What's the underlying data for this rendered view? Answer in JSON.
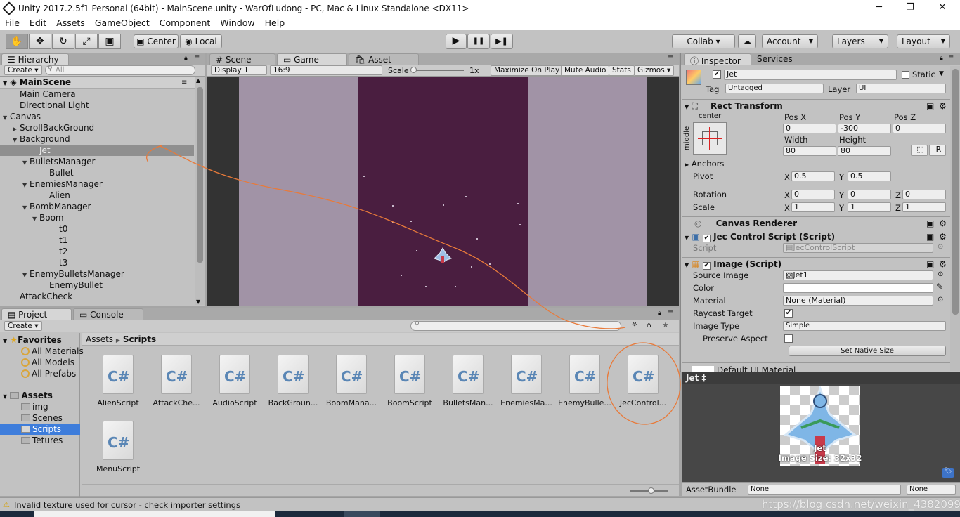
{
  "window": {
    "title": "Unity 2017.2.5f1 Personal (64bit) - MainScene.unity - WarOfLudong - PC, Mac & Linux Standalone <DX11>",
    "minimize": "─",
    "maximize": "❐",
    "close": "✕"
  },
  "menu": [
    "File",
    "Edit",
    "Assets",
    "GameObject",
    "Component",
    "Window",
    "Help"
  ],
  "toolbar": {
    "tools": [
      "✋",
      "✥",
      "↻",
      "⤢",
      "▣"
    ],
    "center": "Center",
    "local": "Local",
    "play": "▶",
    "pause": "❚❚",
    "step": "▶❚",
    "collab": "Collab ▾",
    "cloud": "☁",
    "account": "Account",
    "layers": "Layers",
    "layout": "Layout"
  },
  "hierarchy": {
    "tab": "Hierarchy",
    "create": "Create ▾",
    "search": "All",
    "scene": "MainScene",
    "rows": [
      {
        "text": "Main Camera",
        "indent": 2,
        "arrow": ""
      },
      {
        "text": "Directional Light",
        "indent": 2,
        "arrow": ""
      },
      {
        "text": "Canvas",
        "indent": 1,
        "arrow": "▼"
      },
      {
        "text": "ScrollBackGround",
        "indent": 2,
        "arrow": "▶"
      },
      {
        "text": "Background",
        "indent": 2,
        "arrow": "▼"
      },
      {
        "text": "Jet",
        "indent": 4,
        "arrow": "",
        "sel": true
      },
      {
        "text": "BulletsManager",
        "indent": 3,
        "arrow": "▼"
      },
      {
        "text": "Bullet",
        "indent": 5,
        "arrow": ""
      },
      {
        "text": "EnemiesManager",
        "indent": 3,
        "arrow": "▼"
      },
      {
        "text": "Alien",
        "indent": 5,
        "arrow": ""
      },
      {
        "text": "BombManager",
        "indent": 3,
        "arrow": "▼"
      },
      {
        "text": "Boom",
        "indent": 4,
        "arrow": "▼"
      },
      {
        "text": "t0",
        "indent": 6,
        "arrow": ""
      },
      {
        "text": "t1",
        "indent": 6,
        "arrow": ""
      },
      {
        "text": "t2",
        "indent": 6,
        "arrow": ""
      },
      {
        "text": "t3",
        "indent": 6,
        "arrow": ""
      },
      {
        "text": "EnemyBulletsManager",
        "indent": 3,
        "arrow": "▼"
      },
      {
        "text": "EnemyBullet",
        "indent": 5,
        "arrow": ""
      },
      {
        "text": "AttackCheck",
        "indent": 2,
        "arrow": ""
      }
    ]
  },
  "gameview": {
    "tabs": [
      "# Scene",
      "Game",
      "Asset Store"
    ],
    "display": "Display 1",
    "aspect": "16:9",
    "scale_label": "Scale",
    "scale_value": "1x",
    "toggles": [
      "Maximize On Play",
      "Mute Audio",
      "Stats",
      "Gizmos ▾"
    ]
  },
  "project": {
    "tabs": [
      "Project",
      "Console"
    ],
    "create": "Create ▾",
    "favorites": "Favorites",
    "fav_items": [
      "All Materials",
      "All Models",
      "All Prefabs"
    ],
    "assets": "Assets",
    "folders": [
      "img",
      "Scenes",
      "Scripts",
      "Tetures"
    ],
    "breadcrumb": [
      "Assets",
      "Scripts"
    ],
    "scripts": [
      "AlienScript",
      "AttackChe...",
      "AudioScript",
      "BackGroun...",
      "BoomMana...",
      "BoomScript",
      "BulletsMan...",
      "EnemiesMa...",
      "EnemyBulle...",
      "JecControl...",
      "MenuScript"
    ]
  },
  "inspector": {
    "tabs": [
      "Inspector",
      "Services"
    ],
    "name": "Jet",
    "static": "Static",
    "tag_label": "Tag",
    "tag": "Untagged",
    "layer_label": "Layer",
    "layer": "UI",
    "rect": {
      "title": "Rect Transform",
      "anchor_top": "center",
      "anchor_side": "middle",
      "posx_l": "Pos X",
      "posy_l": "Pos Y",
      "posz_l": "Pos Z",
      "posx": "0",
      "posy": "-300",
      "posz": "0",
      "w_l": "Width",
      "h_l": "Height",
      "w": "80",
      "h": "80",
      "anchors": "Anchors",
      "pivot": "Pivot",
      "pivx": "0.5",
      "pivy": "0.5",
      "rotation": "Rotation",
      "rx": "0",
      "ry": "0",
      "rz": "0",
      "scale": "Scale",
      "sx": "1",
      "sy": "1",
      "sz": "1",
      "r_btn": "R"
    },
    "canvas_renderer": "Canvas Renderer",
    "script": {
      "title": "Jec Control Script (Script)",
      "label": "Script",
      "value": "JecControlScript"
    },
    "image": {
      "title": "Image (Script)",
      "src_l": "Source Image",
      "src": "Jet1",
      "color_l": "Color",
      "mat_l": "Material",
      "mat": "None (Material)",
      "ray_l": "Raycast Target",
      "type_l": "Image Type",
      "type": "Simple",
      "pres_l": "Preserve Aspect",
      "native": "Set Native Size"
    },
    "default_mat": "Default UI Material",
    "preview_title": "Jet ‡",
    "preview_name": "Jet",
    "preview_size": "Image Size: 32x32",
    "assetbundle": "AssetBundle",
    "ab1": "None",
    "ab2": "None"
  },
  "axis": {
    "x": "X",
    "y": "Y",
    "z": "Z"
  },
  "status": "Invalid texture used for cursor - check importer settings",
  "watermark": "https://blog.csdn.net/weixin_43820992"
}
